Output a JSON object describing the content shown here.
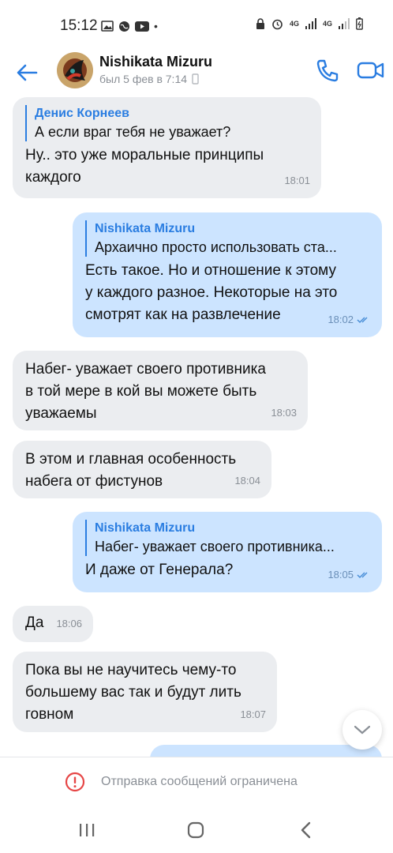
{
  "status_bar": {
    "time": "15:12",
    "dot": "•",
    "net1": "4G",
    "net2": "4G"
  },
  "header": {
    "contact_name": "Nishikata Mizuru",
    "last_seen": "был 5 фев в 7:14",
    "accent_color": "#2a7de1"
  },
  "messages": [
    {
      "direction": "incoming",
      "reply_author": "Денис Корнеев",
      "reply_text": "А если враг тебя не уважает?",
      "text": "Ну.. это уже моральные принципы\nкаждого",
      "time": "18:01"
    },
    {
      "direction": "outgoing",
      "reply_author": "Nishikata Mizuru",
      "reply_text": "Архаично просто использовать ста...",
      "text": "Есть такое. Но и отношение к этому\nу каждого разное. Некоторые на это\nсмотрят как на развлечение",
      "time": "18:02",
      "read": true
    },
    {
      "direction": "incoming",
      "text": "Набег- уважает своего противника\nв той мере в кой вы можете быть\nуважаемы",
      "time": "18:03"
    },
    {
      "direction": "incoming",
      "text": "В этом и главная особенность\nнабега от фистунов",
      "time": "18:04"
    },
    {
      "direction": "outgoing",
      "reply_author": "Nishikata Mizuru",
      "reply_text": "Набег- уважает своего противника...",
      "text": "И даже от Генерала?",
      "time": "18:05",
      "read": true
    },
    {
      "direction": "incoming",
      "text": "Да",
      "time": "18:06"
    },
    {
      "direction": "incoming",
      "text": "Пока вы не научитесь чему-то\nбольшему вас так и будут лить\nговном",
      "time": "18:07"
    }
  ],
  "restriction": {
    "text": "Отправка сообщений ограничена",
    "icon": "alert-circle-icon",
    "color": "#e64646"
  },
  "nav": {
    "recent_icon": "recent-apps-icon",
    "home_icon": "home-icon",
    "back_icon": "back-icon"
  }
}
